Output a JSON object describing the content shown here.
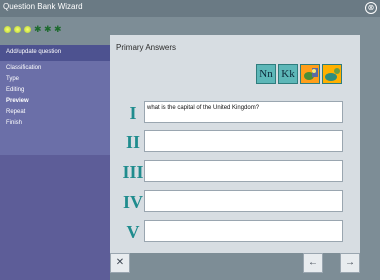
{
  "window": {
    "title": "Question Bank Wizard",
    "close_glyph": "⊗"
  },
  "stepper": {
    "done_count": 3,
    "total_steps": 6,
    "done_icon": "dot-icon",
    "todo_glyph": "✱"
  },
  "sidebar": {
    "header": "Add/update question",
    "items": [
      {
        "label": "Classification"
      },
      {
        "label": "Type"
      },
      {
        "label": "Editing"
      },
      {
        "label": "Preview"
      },
      {
        "label": "Repeat"
      },
      {
        "label": "Finish"
      }
    ]
  },
  "panel": {
    "heading": "Primary Answers",
    "tiles": [
      {
        "name": "uppercase-letter-tile",
        "text": "Nn"
      },
      {
        "name": "lowercase-letter-tile",
        "text": "Kk"
      },
      {
        "name": "picture-tile",
        "text": ""
      },
      {
        "name": "picture-tile-2",
        "text": ""
      }
    ],
    "rows": [
      {
        "label": "I",
        "value": "what is the capital of the United Kingdom?"
      },
      {
        "label": "II",
        "value": ""
      },
      {
        "label": "III",
        "value": ""
      },
      {
        "label": "IV",
        "value": ""
      },
      {
        "label": "V",
        "value": ""
      }
    ]
  },
  "footer": {
    "cancel_glyph": "✕",
    "back_glyph": "←",
    "next_glyph": "→"
  }
}
